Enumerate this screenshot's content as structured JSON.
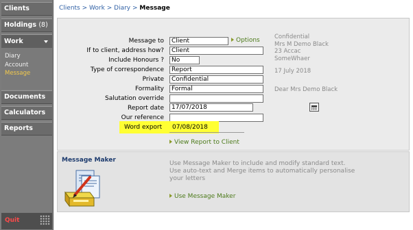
{
  "sidebar": {
    "clients": "Clients",
    "holdings": "Holdings",
    "holdings_count": "(8)",
    "work": "Work",
    "work_items": [
      {
        "label": "Diary"
      },
      {
        "label": "Account"
      },
      {
        "label": "Message"
      }
    ],
    "documents": "Documents",
    "calculators": "Calculators",
    "reports": "Reports",
    "quit": "Quit"
  },
  "breadcrumb": {
    "clients": "Clients",
    "work": "Work",
    "diary": "Diary",
    "sep": ">",
    "current": "Message"
  },
  "form": {
    "message_to_label": "Message to",
    "message_to_value": "Client",
    "options_link": "Options",
    "address_how_label": "If to client, address how?",
    "address_how_value": "Client",
    "honours_label": "Include Honours ?",
    "honours_value": "No",
    "type_label": "Type of correspondence",
    "type_value": "Report",
    "private_label": "Private",
    "private_value": "Confidential",
    "formality_label": "Formality",
    "formality_value": "Formal",
    "salutation_label": "Salutation override",
    "salutation_value": "",
    "report_date_label": "Report date",
    "report_date_value": "17/07/2018",
    "our_ref_label": "Our reference",
    "our_ref_value": "",
    "word_export_label": "Word export",
    "word_export_value": "07/08/2018",
    "view_report_link": "View Report to Client"
  },
  "preview": {
    "line1": "Confidential",
    "line2": "Mrs M Demo Black",
    "line3": "23 Accac",
    "line4": "SomeWhaer",
    "date": "17 July 2018",
    "salutation": "Dear Mrs Demo Black"
  },
  "message_maker": {
    "title": "Message Maker",
    "desc1": "Use Message Maker to include and modify standard text.",
    "desc2": "Use auto-text and Merge items to automatically personalise",
    "desc3": "your letters",
    "link": "Use Message Maker"
  },
  "colors": {
    "sidebar_bg": "#7c7c7c",
    "link_green": "#4c7a1a",
    "breadcrumb_blue": "#2e5fa4",
    "highlight_yellow": "#ffff33",
    "quit_red": "#ff4a4a",
    "active_sub": "#f2c94c"
  },
  "icons": {
    "options_arrow": "arrow-right-icon",
    "calendar": "calendar-icon",
    "message_maker": "message-maker-icon",
    "menu_grid": "grid-icon"
  }
}
